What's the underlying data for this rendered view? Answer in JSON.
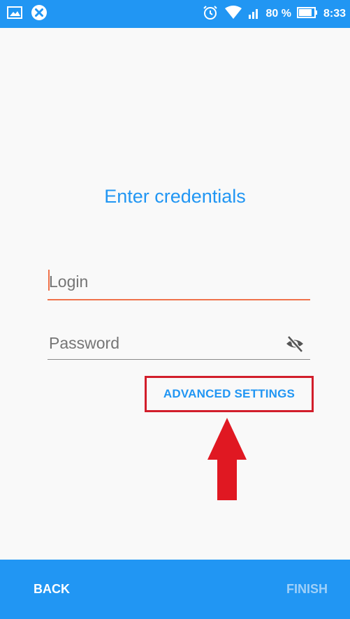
{
  "status_bar": {
    "battery_percent": "80 %",
    "time": "8:33",
    "icons": [
      "image-icon",
      "close-circle-icon",
      "alarm-icon",
      "wifi-icon",
      "signal-icon",
      "battery-icon"
    ]
  },
  "title": "Enter credentials",
  "login": {
    "placeholder": "Login",
    "value": ""
  },
  "password": {
    "placeholder": "Password",
    "value": "",
    "visibility_icon": "eye-off-icon"
  },
  "advanced_settings_label": "ADVANCED SETTINGS",
  "annotation": {
    "highlight_color": "#d21e2b",
    "arrow_icon": "arrow-up-icon"
  },
  "bottom_bar": {
    "back_label": "BACK",
    "finish_label": "FINISH"
  },
  "colors": {
    "primary": "#2196f3",
    "accent": "#f0734b",
    "annotation_red": "#d21e2b",
    "disabled_text": "#9fd0f8"
  }
}
